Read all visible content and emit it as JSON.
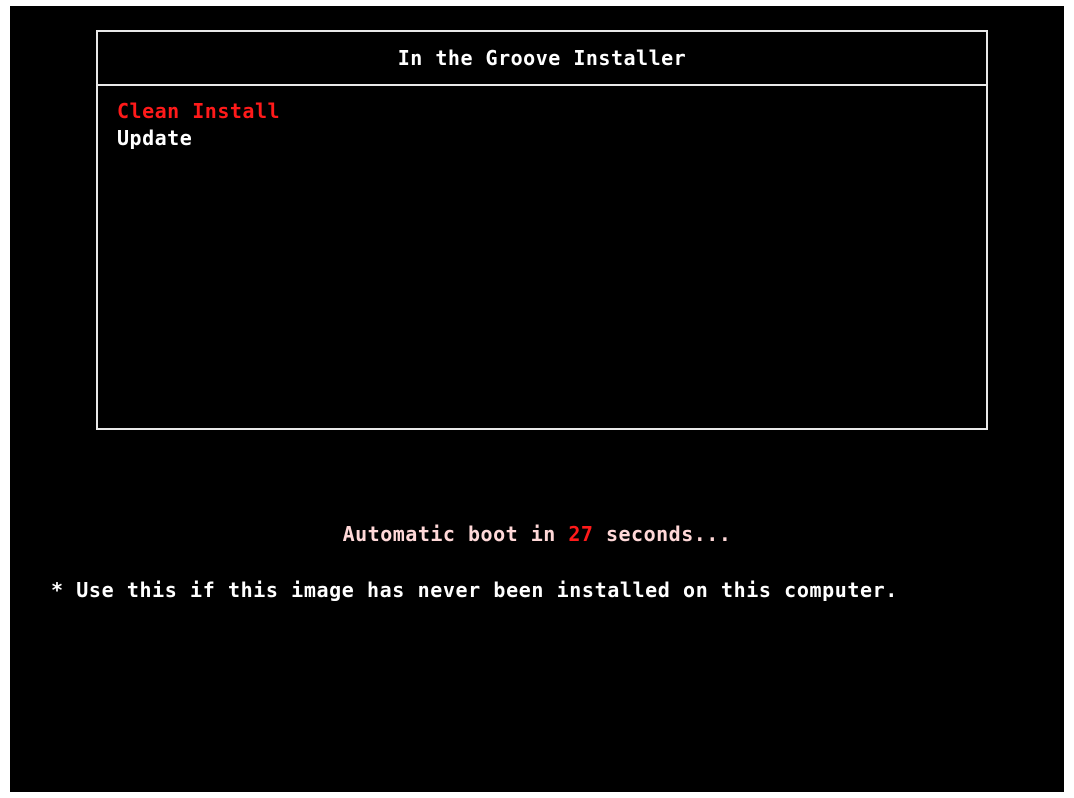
{
  "menu": {
    "title": "In the Groove Installer",
    "items": [
      {
        "label": "Clean Install",
        "selected": true
      },
      {
        "label": "Update",
        "selected": false
      }
    ]
  },
  "countdown": {
    "prefix": "Automatic boot in ",
    "seconds": "27",
    "suffix": " seconds..."
  },
  "help_text": "* Use this if this image has never been installed on this computer.",
  "colors": {
    "background": "#000000",
    "selected": "#ff1a1a",
    "text": "#ffffff",
    "border": "#e8e8e8"
  }
}
